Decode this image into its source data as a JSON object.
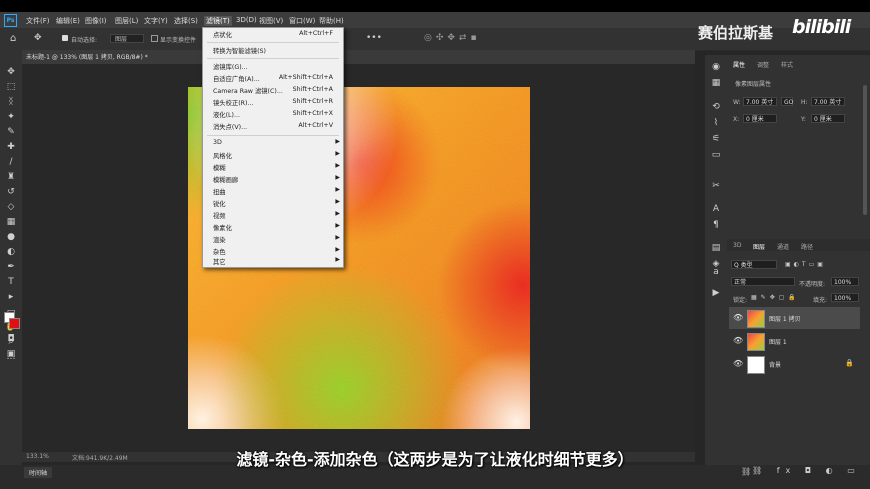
{
  "menubar": {
    "ps_logo": "Ps",
    "items": [
      "文件(F)",
      "编辑(E)",
      "图像(I)",
      "图层(L)",
      "文字(Y)",
      "选择(S)",
      "滤镜(T)",
      "3D(D)",
      "视图(V)",
      "窗口(W)",
      "帮助(H)"
    ],
    "active_index": 6
  },
  "options_bar": {
    "auto_select_label": "自动选择:",
    "auto_select_value": "图层",
    "show_transform_label": "显示变换控件"
  },
  "document": {
    "tab_title": "未标题-1 @ 133% (图层 1 拷贝, RGB/8#) *",
    "zoom": "133.1%",
    "doc_size": "文档:941.9K/2.49M"
  },
  "timeline": {
    "label": "时间轴"
  },
  "watermark": {
    "text": "赛伯拉斯基",
    "logo": "bilibili"
  },
  "subtitle": "滤镜-杂色-添加杂色（这两步是为了让液化时细节更多）",
  "filter_menu": {
    "top_items": [
      {
        "label": "点状化",
        "shortcut": "Alt+Ctrl+F"
      }
    ],
    "group2": [
      {
        "label": "转换为智能滤镜(S)",
        "shortcut": ""
      }
    ],
    "group3": [
      {
        "label": "滤镜库(G)...",
        "shortcut": ""
      },
      {
        "label": "自适应广角(A)...",
        "shortcut": "Alt+Shift+Ctrl+A"
      },
      {
        "label": "Camera Raw 滤镜(C)...",
        "shortcut": "Shift+Ctrl+A"
      },
      {
        "label": "镜头校正(R)...",
        "shortcut": "Shift+Ctrl+R"
      },
      {
        "label": "液化(L)...",
        "shortcut": "Shift+Ctrl+X"
      },
      {
        "label": "消失点(V)...",
        "shortcut": "Alt+Ctrl+V"
      }
    ],
    "submenus": [
      "3D",
      "风格化",
      "模糊",
      "模糊画廊",
      "扭曲",
      "锐化",
      "视频",
      "像素化",
      "渲染",
      "杂色",
      "其它"
    ]
  },
  "properties_panel": {
    "tabs": [
      "属性",
      "调整",
      "样式"
    ],
    "heading": "像素图层属性",
    "w_label": "W:",
    "w_value": "7.00 英寸",
    "link_label": "GO",
    "h_label": "H:",
    "h_value": "7.00 英寸",
    "x_label": "X:",
    "x_value": "0 厘米",
    "y_label": "Y:",
    "y_value": "0 厘米"
  },
  "layers_panel": {
    "tabs": [
      "3D",
      "图层",
      "通道",
      "路径"
    ],
    "kind_label": "Q 类型",
    "blend_mode": "正常",
    "opacity_label": "不透明度:",
    "opacity_value": "100%",
    "lock_label": "锁定:",
    "fill_label": "填充:",
    "fill_value": "100%",
    "layers": [
      {
        "name": "图层 1 拷贝",
        "selected": true
      },
      {
        "name": "图层 1",
        "selected": false
      },
      {
        "name": "背景",
        "selected": false
      }
    ],
    "footer_icons": [
      "link-icon",
      "fx-icon",
      "mask-icon",
      "adjustment-icon",
      "group-icon",
      "new-layer-icon",
      "trash-icon"
    ]
  }
}
